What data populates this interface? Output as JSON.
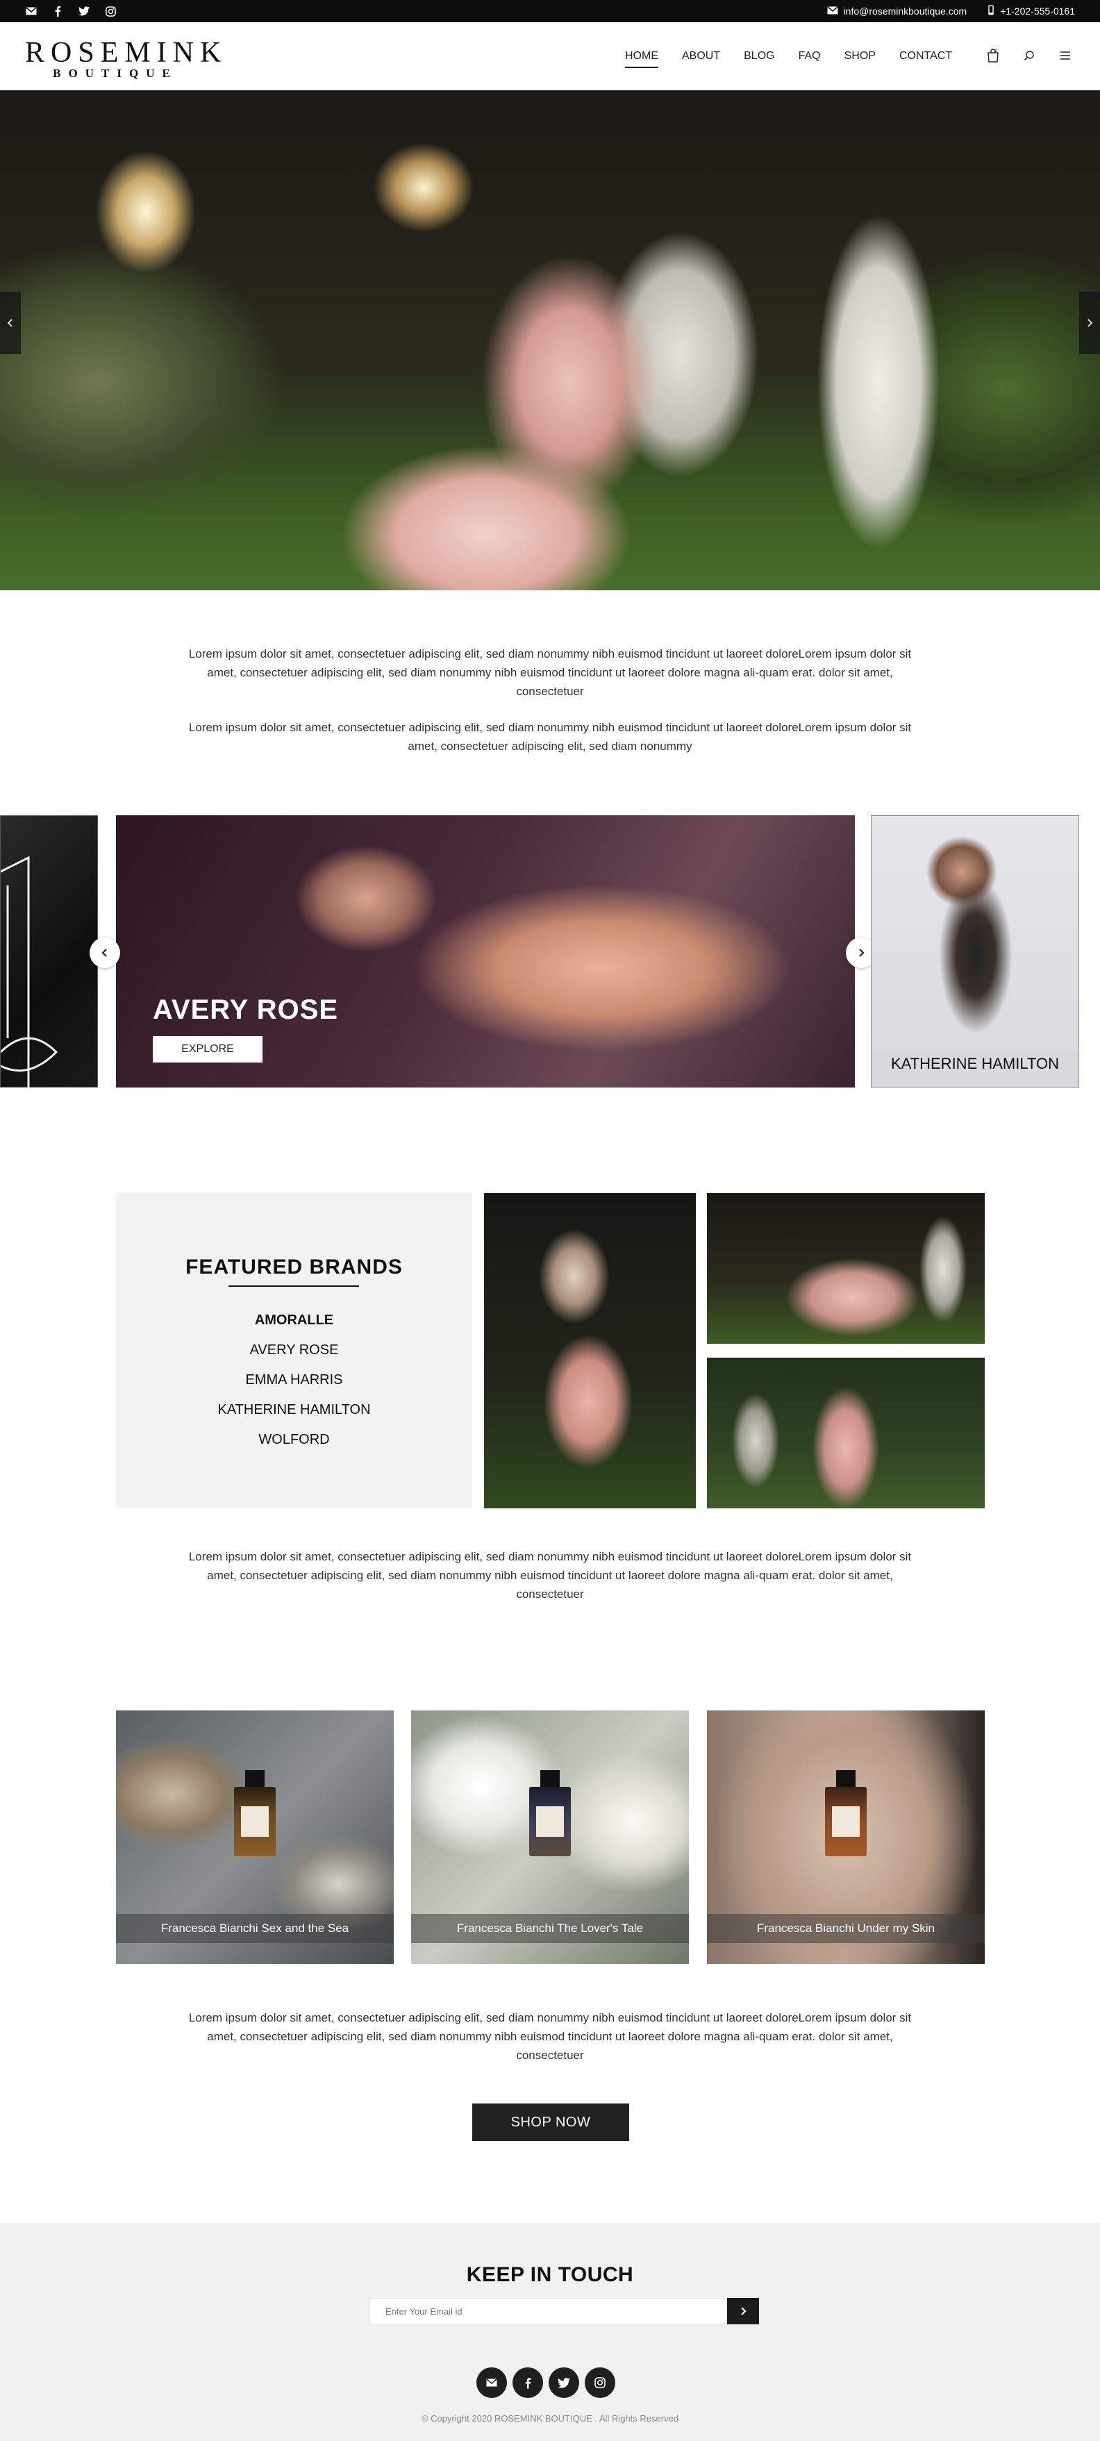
{
  "topbar": {
    "socials": [
      {
        "icon": "mail-icon",
        "name": "topbar-mail-icon"
      },
      {
        "icon": "facebook-icon",
        "name": "topbar-facebook-icon"
      },
      {
        "icon": "twitter-icon",
        "name": "topbar-twitter-icon"
      },
      {
        "icon": "instagram-icon",
        "name": "topbar-instagram-icon"
      }
    ],
    "email": "info@roseminkboutique.com",
    "phone": "+1-202-555-0161"
  },
  "logo": {
    "line1": "ROSEMINK",
    "line2": "BOUTIQUE"
  },
  "nav": {
    "items": [
      "HOME",
      "ABOUT",
      "BLOG",
      "FAQ",
      "SHOP",
      "CONTACT"
    ],
    "active": "HOME"
  },
  "intro": {
    "p1": "Lorem ipsum dolor sit amet, consectetuer adipiscing elit,  sed diam nonummy nibh euismod tincidunt ut laoreet doloreLorem ipsum dolor sit amet, consectetuer adipiscing elit, sed diam nonummy nibh euismod tincidunt ut laoreet dolore magna ali-quam erat. dolor sit amet, consectetuer",
    "p2": "Lorem ipsum dolor sit amet, consectetuer adipiscing elit,  sed diam nonummy nibh euismod tincidunt ut laoreet doloreLorem ipsum dolor sit amet, consectetuer adipiscing elit, sed diam nonummy"
  },
  "carousel": {
    "main_brand": "AVERY ROSE",
    "explore_label": "EXPLORE",
    "right_brand": "KATHERINE HAMILTON"
  },
  "featured": {
    "title": "FEATURED  BRANDS",
    "brands": [
      "AMORALLE",
      "AVERY ROSE",
      "EMMA HARRIS",
      "KATHERINE HAMILTON",
      "WOLFORD"
    ],
    "paragraph": "Lorem ipsum dolor sit amet, consectetuer adipiscing elit,  sed diam nonummy nibh euismod tincidunt ut laoreet doloreLorem ipsum dolor sit amet, consectetuer adipiscing elit, sed diam nonummy nibh euismod tincidunt ut laoreet dolore magna ali-quam erat. dolor sit amet, consectetuer"
  },
  "products": {
    "items": [
      "Francesca Bianchi Sex and the Sea",
      "Francesca Bianchi The Lover's Tale",
      "Francesca Bianchi Under my Skin"
    ],
    "paragraph": "Lorem ipsum dolor sit amet, consectetuer adipiscing elit,  sed diam nonummy nibh euismod tincidunt ut laoreet doloreLorem ipsum dolor sit amet, consectetuer adipiscing elit, sed diam nonummy nibh euismod tincidunt ut laoreet dolore magna ali-quam erat. dolor sit amet, consectetuer",
    "shop_now": "SHOP NOW"
  },
  "footer": {
    "title": "KEEP IN TOUCH",
    "email_placeholder": "Enter Your Email id",
    "socials": [
      "mail-icon",
      "facebook-icon",
      "twitter-icon",
      "instagram-icon"
    ],
    "copyright": "© Copyright 2020 ROSEMINK BOUTIQUE . All Rights Reserved"
  }
}
